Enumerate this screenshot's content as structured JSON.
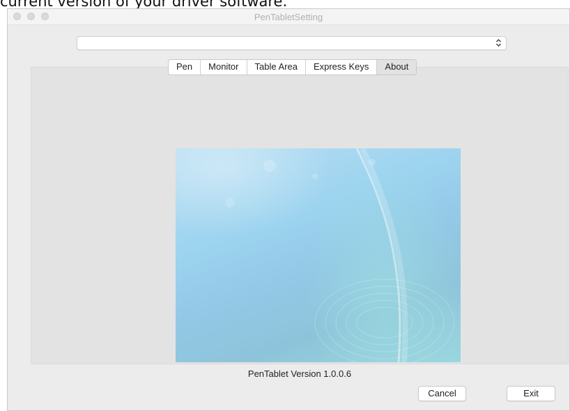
{
  "caption": "current version of your driver software.",
  "window": {
    "title": "PenTabletSetting"
  },
  "device_select": {
    "value": ""
  },
  "tabs": [
    {
      "label": "Pen"
    },
    {
      "label": "Monitor"
    },
    {
      "label": "Table Area"
    },
    {
      "label": "Express Keys"
    },
    {
      "label": "About"
    }
  ],
  "active_tab": "About",
  "about": {
    "version_text": "PenTablet Version  1.0.0.6"
  },
  "buttons": {
    "cancel": "Cancel",
    "exit": "Exit"
  },
  "icons": {
    "select_arrow": "chevron-up-down-icon"
  }
}
